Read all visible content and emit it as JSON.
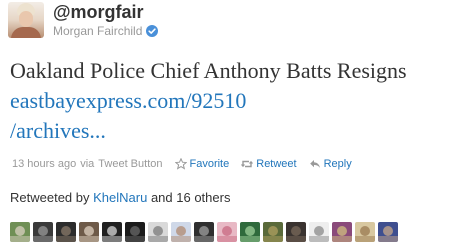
{
  "author": {
    "screen_name": "@morgfair",
    "full_name": "Morgan Fairchild",
    "verified": true
  },
  "tweet": {
    "text": "Oakland Police Chief Anthony Batts Resigns ",
    "link_text": "eastbayexpress.com/92510/archives...",
    "link_line1": "eastbayexpress.com/92510",
    "link_line2": "/archives..."
  },
  "meta": {
    "time": "13 hours ago",
    "via_prefix": "via",
    "source": "Tweet Button",
    "favorite": "Favorite",
    "retweet": "Retweet",
    "reply": "Reply"
  },
  "retweets": {
    "prefix": "Retweeted by",
    "user": "KhelNaru",
    "suffix": "and 16 others",
    "avatars": [
      {
        "bg": "#6f8f55",
        "fg": "#d9d0c2"
      },
      {
        "bg": "#3a3a3a",
        "fg": "#9a9a9a"
      },
      {
        "bg": "#2c2c2c",
        "fg": "#8a7a6a"
      },
      {
        "bg": "#6e5a48",
        "fg": "#e0d2c0"
      },
      {
        "bg": "#202020",
        "fg": "#d8d8d8"
      },
      {
        "bg": "#1b1b1b",
        "fg": "#6a6a6a"
      },
      {
        "bg": "#d9d9d9",
        "fg": "#7a7a7a"
      },
      {
        "bg": "#cfd8e8",
        "fg": "#b08a70"
      },
      {
        "bg": "#2f2f2f",
        "fg": "#a0a0a0"
      },
      {
        "bg": "#e8b9c5",
        "fg": "#c86a80"
      },
      {
        "bg": "#2f6a3c",
        "fg": "#9fd09a"
      },
      {
        "bg": "#5a6a3a",
        "fg": "#b0a060"
      },
      {
        "bg": "#3a3330",
        "fg": "#7a6a5a"
      },
      {
        "bg": "#eeeeee",
        "fg": "#8a8a8a"
      },
      {
        "bg": "#8a4a7a",
        "fg": "#d0c080"
      },
      {
        "bg": "#d8c8a0",
        "fg": "#9a7a50"
      },
      {
        "bg": "#3f4f8f",
        "fg": "#c9a88a"
      }
    ]
  },
  "colors": {
    "link": "#2276bb",
    "meta_text": "#999999",
    "verified_badge": "#4a90d9"
  },
  "icons": {
    "verified": "verified-badge-icon",
    "favorite": "star-icon",
    "retweet": "retweet-icon",
    "reply": "reply-arrow-icon"
  }
}
